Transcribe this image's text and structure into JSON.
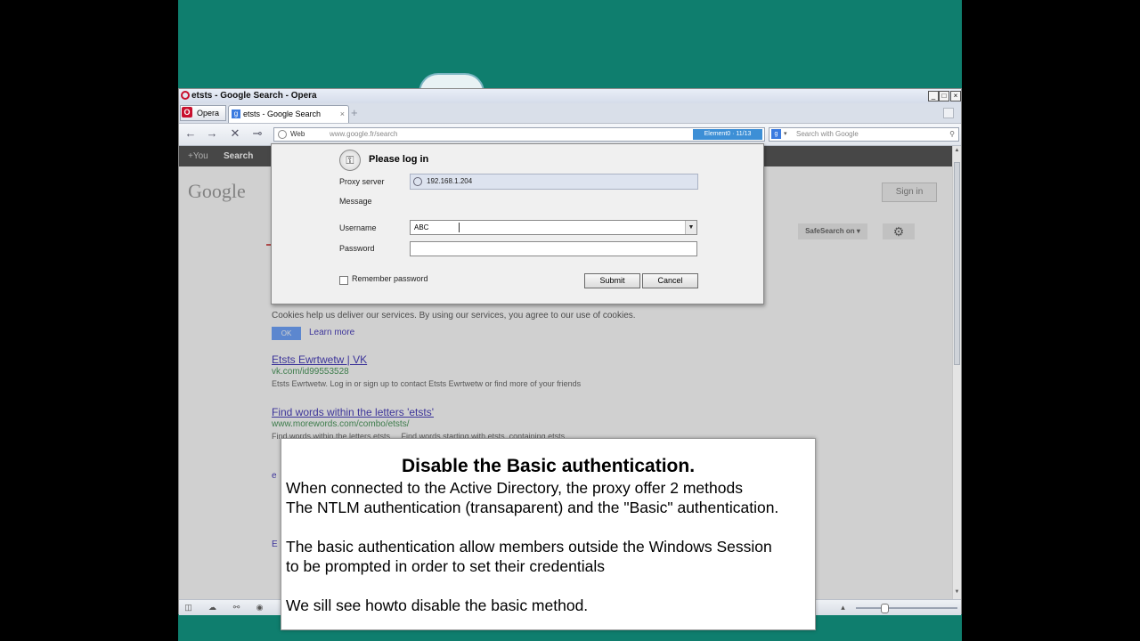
{
  "window": {
    "title": "etsts - Google Search - Opera",
    "controls": [
      "_",
      "□",
      "×"
    ]
  },
  "tabs": {
    "menu_label": "Opera",
    "active_tab": "etsts - Google Search",
    "close": "×",
    "new": "+"
  },
  "navbar": {
    "address_prefix": "Web",
    "url": "www.google.fr/search",
    "element_badge": "Element0 · 11/13",
    "search_placeholder": "Search with Google"
  },
  "google": {
    "bar_you": "+You",
    "bar_search": "Search",
    "logo": "Google",
    "signin": "Sign in",
    "safesearch": "SafeSearch on ▾",
    "cookie_text": "Cookies help us deliver our services. By using our services, you agree to our use of cookies.",
    "ok": "OK",
    "learn_more": "Learn more",
    "results": [
      {
        "title": "Etsts Ewrtwetw | VK",
        "url": "vk.com/id99553528",
        "snippet": "Etsts Ewrtwetw. Log in or sign up to contact Etsts Ewrtwetw or find more of your friends"
      },
      {
        "title": "Find words within the letters 'etsts'",
        "url": "www.morewords.com/combo/etsts/",
        "snippet": "Find words within the letters etsts ... Find words starting with etsts, containing etsts"
      }
    ]
  },
  "dialog": {
    "title": "Please log in",
    "proxy_label": "Proxy server",
    "proxy_value": "192.168.1.204",
    "message_label": "Message",
    "username_label": "Username",
    "username_value": "ABC",
    "password_label": "Password",
    "remember_label": "Remember password",
    "submit": "Submit",
    "cancel": "Cancel"
  },
  "caption": {
    "title": "Disable the Basic authentication.",
    "lines": [
      "When connected to the Active Directory, the proxy offer 2 methods",
      "The NTLM authentication (transaparent) and the \"Basic\" authentication.",
      "The basic authentication allow members outside the Windows Session",
      "to be prompted in order to set their credentials",
      "We sill see howto disable the basic method."
    ]
  },
  "colors": {
    "desktop": "#0f7e6e",
    "link": "#1a0dab",
    "url_green": "#1e7e34",
    "ok_blue": "#4d90fe"
  }
}
